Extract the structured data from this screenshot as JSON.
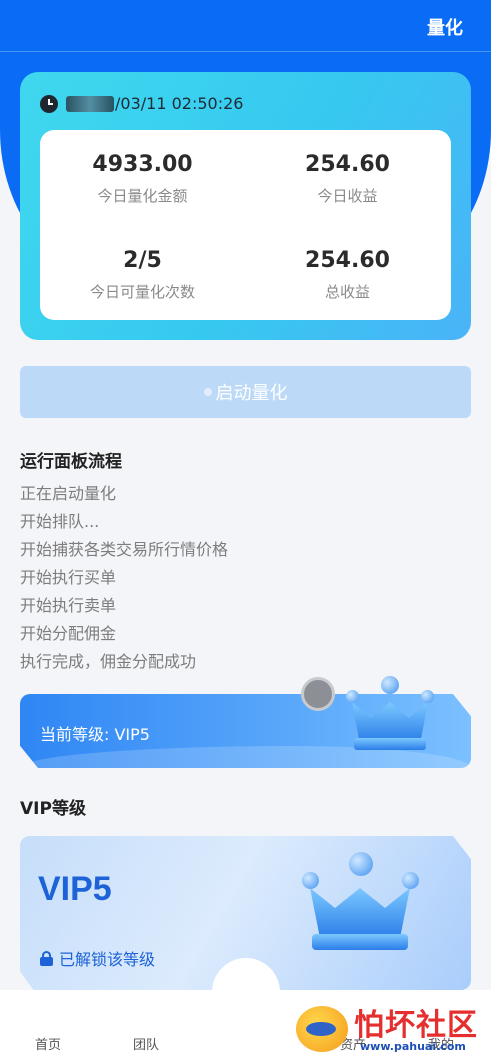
{
  "header": {
    "title": "量化"
  },
  "stats": {
    "time_text": "/03/11 02:50:26",
    "items": [
      {
        "value": "4933.00",
        "label": "今日量化金额"
      },
      {
        "value": "254.60",
        "label": "今日收益"
      },
      {
        "value": "2/5",
        "label": "今日可量化次数"
      },
      {
        "value": "254.60",
        "label": "总收益"
      }
    ]
  },
  "actions": {
    "start_label": "启动量化"
  },
  "flow": {
    "title": "运行面板流程",
    "steps": [
      "正在启动量化",
      "开始排队...",
      "开始捕获各类交易所行情价格",
      "开始执行买单",
      "开始执行卖单",
      "开始分配佣金",
      "执行完成，佣金分配成功"
    ]
  },
  "level": {
    "current_text": "当前等级: VIP5"
  },
  "vip": {
    "section_title": "VIP等级",
    "card_name": "VIP5",
    "status_text": "已解锁该等级"
  },
  "tabbar": {
    "items": [
      "首页",
      "团队",
      "资产",
      "我的"
    ]
  },
  "watermark": {
    "title": "怕坏社区",
    "url": "www.pahuai.com"
  },
  "colors": {
    "primary": "#0a6cf5",
    "vip_blue": "#1d62d6",
    "card_cyan": "#3fd8ee"
  }
}
